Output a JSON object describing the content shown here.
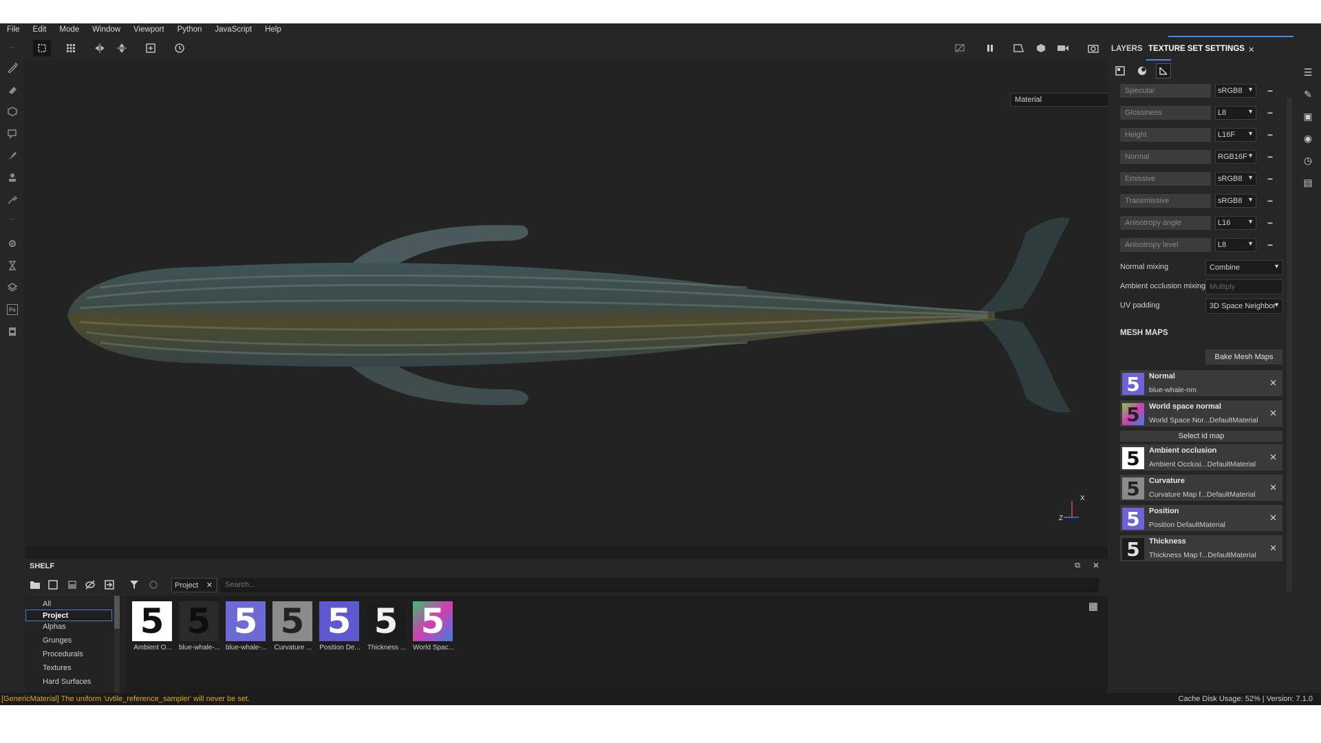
{
  "menu": [
    "File",
    "Edit",
    "Mode",
    "Window",
    "Viewport",
    "Python",
    "JavaScript",
    "Help"
  ],
  "viewport": {
    "display_select": "Material",
    "axis_x": "X",
    "axis_z": "Z"
  },
  "right_panel": {
    "tabs": [
      "LAYERS",
      "TEXTURE SET SETTINGS"
    ],
    "close": "✕",
    "channels": [
      {
        "name": "Specular",
        "format": "sRGB8"
      },
      {
        "name": "Glossiness",
        "format": "L8"
      },
      {
        "name": "Height",
        "format": "L16F"
      },
      {
        "name": "Normal",
        "format": "RGB16F"
      },
      {
        "name": "Emissive",
        "format": "sRGB8"
      },
      {
        "name": "Transmissive",
        "format": "sRGB8"
      },
      {
        "name": "Anisotropy angle",
        "format": "L16"
      },
      {
        "name": "Anisotropy level",
        "format": "L8"
      }
    ],
    "normal_mixing": {
      "label": "Normal mixing",
      "value": "Combine"
    },
    "ao_mixing": {
      "label": "Ambient occlusion mixing",
      "value": "Multiply"
    },
    "uv_padding": {
      "label": "UV padding",
      "value": "3D Space Neighbor"
    },
    "mesh_maps_title": "MESH MAPS",
    "bake_button": "Bake Mesh Maps",
    "select_id_map": "Select id map",
    "mesh_maps": [
      {
        "name": "Normal",
        "value": "blue-whale-nm",
        "color": "#6b63d6"
      },
      {
        "name": "World space normal",
        "value": "World Space Nor...DefaultMaterial",
        "color": "#7ad04b"
      },
      {
        "name": "Ambient occlusion",
        "value": "Ambient Occlusi...DefaultMaterial",
        "color": "#ffffff"
      },
      {
        "name": "Curvature",
        "value": "Curvature Map f...DefaultMaterial",
        "color": "#8a8a8a"
      },
      {
        "name": "Position",
        "value": "Position DefaultMaterial",
        "color": "#6b63d6"
      },
      {
        "name": "Thickness",
        "value": "Thickness Map f...DefaultMaterial",
        "color": "#d0d0d0"
      }
    ]
  },
  "shelf": {
    "title": "SHELF",
    "filter_tag": "Project",
    "search_placeholder": "Search...",
    "categories": [
      "All",
      "Project",
      "Alphas",
      "Grunges",
      "Procedurals",
      "Textures",
      "Hard Surfaces"
    ],
    "selected_category": "Project",
    "items": [
      {
        "label": "Ambient O...",
        "bg": "#ffffff",
        "fg": "#111111"
      },
      {
        "label": "blue-whale-...",
        "bg": "#2a2a2a",
        "fg": "#111111"
      },
      {
        "label": "blue-whale-...",
        "bg": "#6d6ad8",
        "fg": "#ffffff"
      },
      {
        "label": "Curvature ...",
        "bg": "#8a8a8a",
        "fg": "#222222"
      },
      {
        "label": "Position De...",
        "bg": "#5d5ad0",
        "fg": "#ffffff"
      },
      {
        "label": "Thickness ...",
        "bg": "#1c1c1c",
        "fg": "#f0f0f0"
      },
      {
        "label": "World Spac...",
        "bg": "#38c070",
        "fg": "#ff3fa0"
      }
    ]
  },
  "status": {
    "error": "[GenericMaterial] The uniform 'uvtile_reference_sampler' will never be set.",
    "cache": "Cache Disk Usage:    52% | Version: 7.1.0"
  }
}
